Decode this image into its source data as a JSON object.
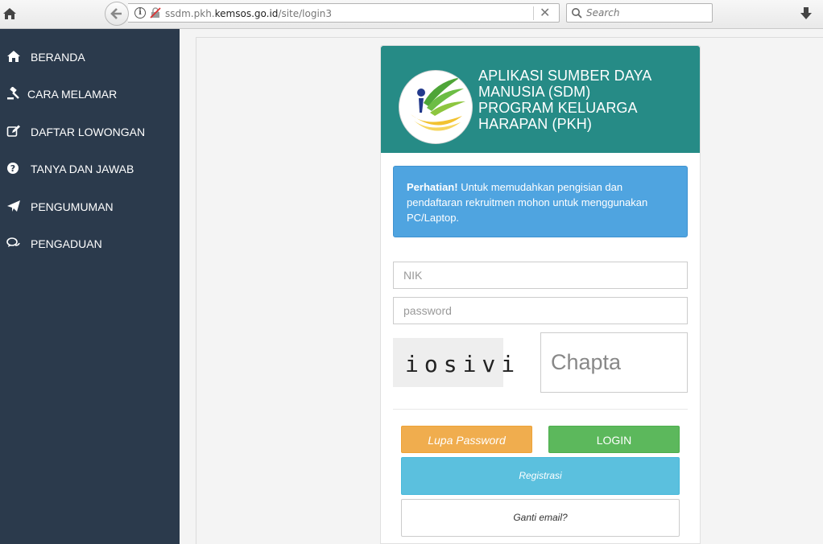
{
  "browser": {
    "url_prefix": "ssdm.pkh.",
    "url_domain": "kemsos.go.id",
    "url_path": "/site/login3",
    "search_placeholder": "Search"
  },
  "sidebar": {
    "items": [
      {
        "label": "BERANDA",
        "icon": "home-icon"
      },
      {
        "label": "CARA MELAMAR",
        "icon": "gavel-icon"
      },
      {
        "label": "DAFTAR LOWONGAN",
        "icon": "edit-icon"
      },
      {
        "label": "TANYA DAN JAWAB",
        "icon": "question-circle-icon"
      },
      {
        "label": "PENGUMUMAN",
        "icon": "paper-plane-icon"
      },
      {
        "label": "PENGADUAN",
        "icon": "comments-icon"
      }
    ]
  },
  "login": {
    "title_lines": [
      "APLIKASI SUMBER DAYA",
      "MANUSIA (SDM)",
      "PROGRAM KELUARGA",
      "HARAPAN (PKH)"
    ],
    "alert_strong": "Perhatian!",
    "alert_text": " Untuk memudahkan pengisian dan pendaftaran rekruitmen mohon untuk menggunakan PC/Laptop.",
    "nik_placeholder": "NIK",
    "password_placeholder": "password",
    "captcha_text": "iosivi",
    "captcha_placeholder": "Chapta",
    "forgot_label": "Lupa Password",
    "login_label": "LOGIN",
    "register_label": "Registrasi",
    "change_email_label": "Ganti email?"
  },
  "colors": {
    "sidebar_bg": "#2b3a4c",
    "header_teal": "#268b86",
    "alert_blue": "#4fa4e0",
    "forgot_orange": "#f0ad4e",
    "login_green": "#5cb85c",
    "register_cyan": "#5bc0de"
  }
}
